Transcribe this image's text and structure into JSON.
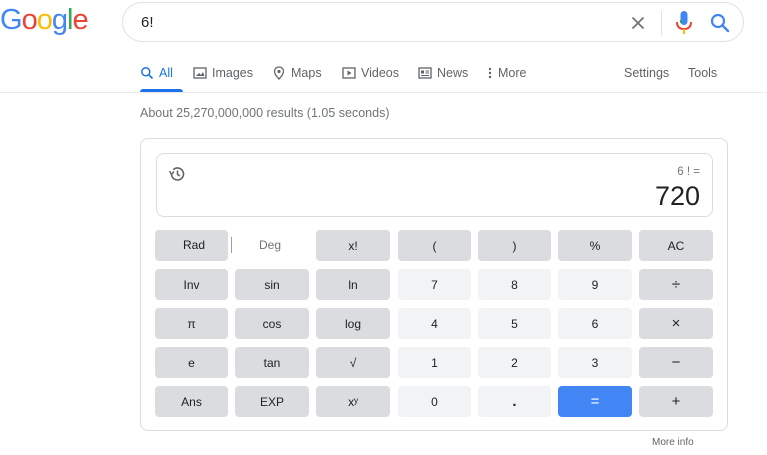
{
  "logo": {
    "letters": [
      "G",
      "o",
      "o",
      "g",
      "l",
      "e"
    ],
    "colors": [
      "#4285f4",
      "#ea4335",
      "#fbbc05",
      "#4285f4",
      "#34a853",
      "#ea4335"
    ]
  },
  "search": {
    "query": "6!",
    "clear_icon": "close-icon",
    "mic_icon": "mic-icon",
    "search_icon": "search-icon"
  },
  "tabs": [
    {
      "label": "All",
      "icon": "search-icon"
    },
    {
      "label": "Images",
      "icon": "image-icon"
    },
    {
      "label": "Maps",
      "icon": "map-pin-icon"
    },
    {
      "label": "Videos",
      "icon": "play-icon"
    },
    {
      "label": "News",
      "icon": "news-icon"
    },
    {
      "label": "More",
      "icon": "more-vert-icon"
    }
  ],
  "settings_label": "Settings",
  "tools_label": "Tools",
  "result_stats": "About 25,270,000,000 results (1.05 seconds)",
  "calculator": {
    "expression": "6 ! =",
    "result": "720",
    "rad_label": "Rad",
    "deg_label": "Deg",
    "keys": [
      [
        "x!",
        "(",
        ")",
        "%",
        "AC"
      ],
      [
        "Inv",
        "sin",
        "ln",
        "7",
        "8",
        "9",
        "÷"
      ],
      [
        "π",
        "cos",
        "log",
        "4",
        "5",
        "6",
        "×"
      ],
      [
        "e",
        "tan",
        "√",
        "1",
        "2",
        "3",
        "−"
      ],
      [
        "Ans",
        "EXP",
        "xʸ",
        "0",
        ".",
        "=",
        "+"
      ]
    ]
  },
  "more_info": "More info",
  "colors": {
    "accent": "#1a73e8",
    "equals": "#4285f4",
    "fn_key": "#dadce0",
    "num_key": "#f1f3f4"
  }
}
